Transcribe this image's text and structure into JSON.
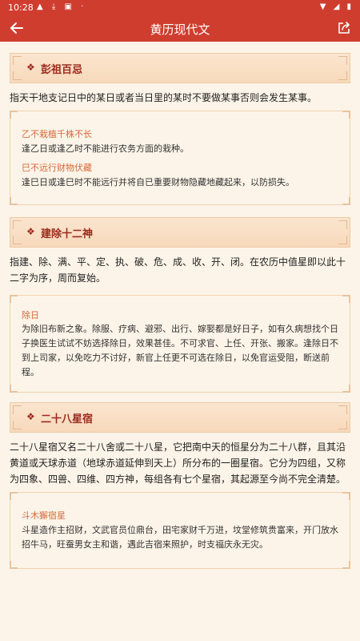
{
  "status": {
    "time": "10:28",
    "left_icons": "▲ ⤓ ▣ ·",
    "right_icons": "▼ ◢ ▮"
  },
  "header": {
    "title": "黄历现代文",
    "back_icon": "back-arrow-icon",
    "share_icon": "share-icon"
  },
  "colors": {
    "app_bar": "#cf3d2f",
    "background": "#fcf4e8",
    "section_title": "#9c2a1c",
    "item_title": "#d8693c"
  },
  "sections": [
    {
      "bullet": "❖",
      "title": "彭祖百忌",
      "description": "指天干地支记日中的某日或者当日里的某时不要做某事否则会发生某事。",
      "items": [
        {
          "title": "乙不栽植千株不长",
          "text": "逢乙日或逢乙时不能进行农务方面的栽种。"
        },
        {
          "title": "巳不远行财物伏藏",
          "text": "逢巳日或逢巳时不能远行并将自已重要财物隐藏地藏起来，以防损失。"
        }
      ]
    },
    {
      "bullet": "❖",
      "title": "建除十二神",
      "description": "指建、除、满、平、定、执、破、危、成、收、开、闭。在农历中值星即以此十二字为序，周而复始。",
      "items": [
        {
          "title": "除日",
          "text": "为除旧布新之象。除服、疗病、避邪、出行、嫁娶都是好日子，如有久病想找个日子换医生试试不妨选择除日，效果甚佳。不可求官、上任、开张、搬家。逢除日不到上司家，以免吃力不讨好，新官上任更不可选在除日，以免官运受阻，断送前程。"
        }
      ]
    },
    {
      "bullet": "❖",
      "title": "二十八星宿",
      "description": "二十八星宿又名二十八舍或二十八星，它把南中天的恒星分为二十八群，且其沿黄道或天球赤道（地球赤道延伸到天上）所分布的一圈星宿。它分为四组，又称为四象、四兽、四维、四方神，每组各有七个星宿，其起源至今尚不完全清楚。",
      "items": [
        {
          "title": "斗木獬宿星",
          "text": "斗星造作主招财，文武官员位鼎台，田宅家财千万进，坟堂修筑贵富来，开门放水招牛马，旺蚕男女主和谐，遇此吉宿来照护，时支福庆永无灾。"
        }
      ]
    }
  ]
}
